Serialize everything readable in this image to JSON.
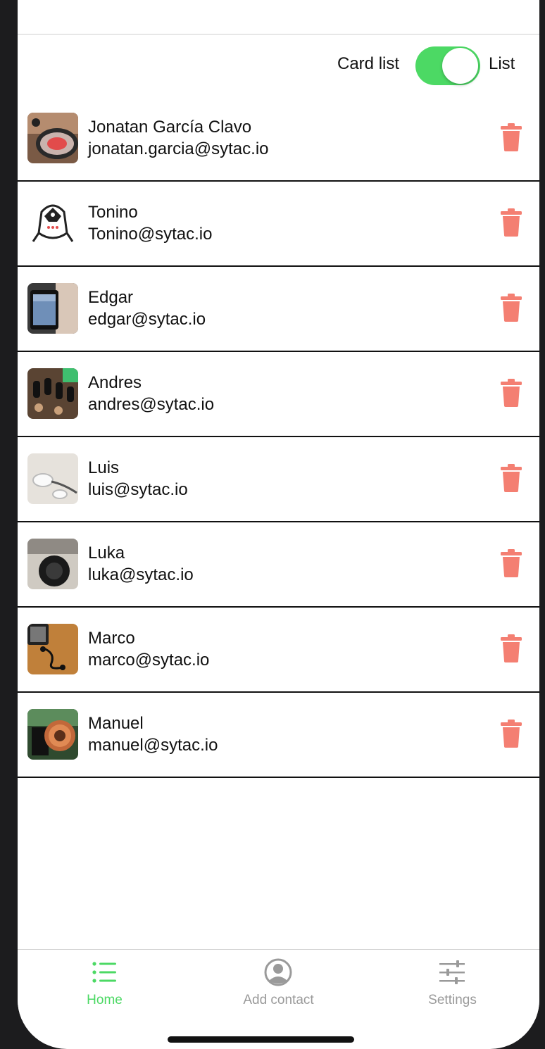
{
  "toggle": {
    "left_label": "Card list",
    "right_label": "List",
    "on": true,
    "accent": "#4cd964"
  },
  "contacts": [
    {
      "name": "Jonatan García Clavo",
      "email": "jonatan.garcia@sytac.io"
    },
    {
      "name": "Tonino",
      "email": "Tonino@sytac.io"
    },
    {
      "name": "Edgar",
      "email": "edgar@sytac.io"
    },
    {
      "name": "Andres",
      "email": "andres@sytac.io"
    },
    {
      "name": "Luis",
      "email": "luis@sytac.io"
    },
    {
      "name": "Luka",
      "email": "luka@sytac.io"
    },
    {
      "name": "Marco",
      "email": "marco@sytac.io"
    },
    {
      "name": "Manuel",
      "email": "manuel@sytac.io"
    }
  ],
  "delete_icon": "trash-icon",
  "delete_color": "#f47f72",
  "tabbar": {
    "tabs": [
      {
        "label": "Home",
        "icon": "list-icon",
        "active": true
      },
      {
        "label": "Add contact",
        "icon": "user-circle-icon",
        "active": false
      },
      {
        "label": "Settings",
        "icon": "sliders-icon",
        "active": false
      }
    ],
    "active_color": "#4cd964",
    "inactive_color": "#9a9a9a"
  }
}
